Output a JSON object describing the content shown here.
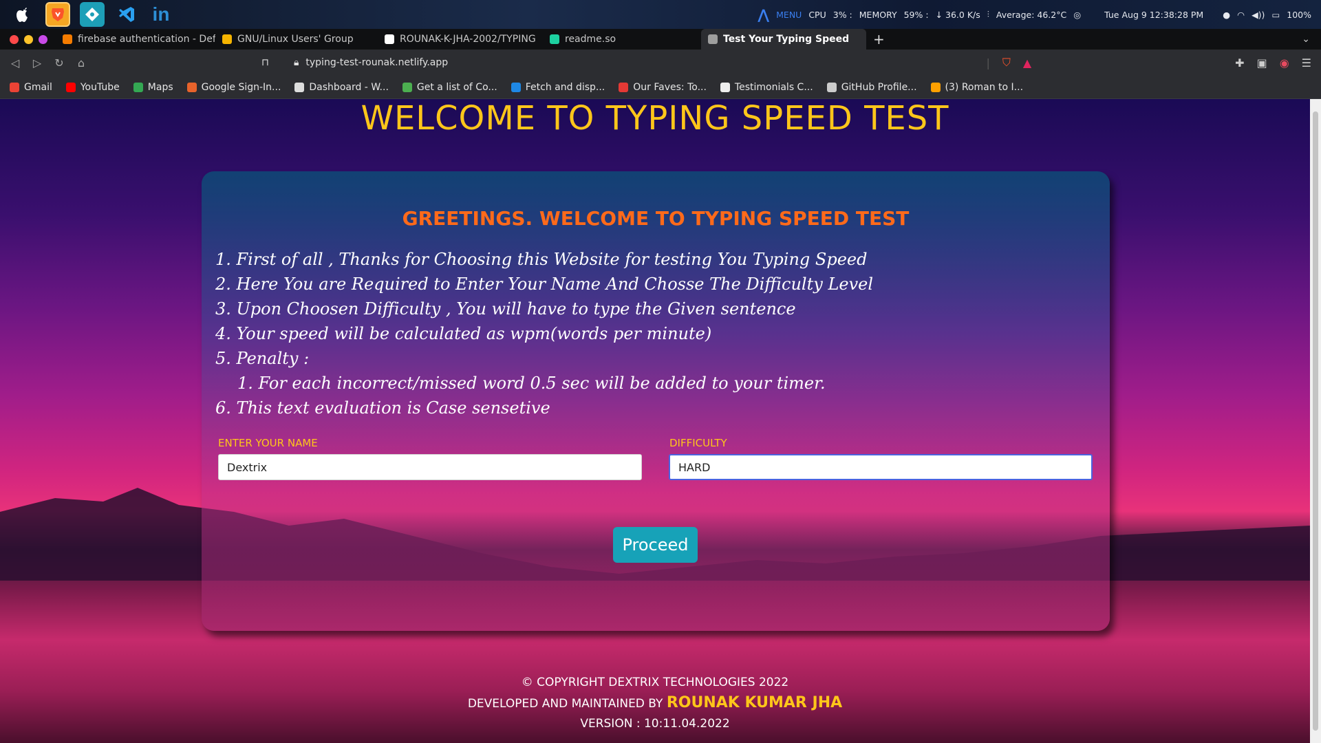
{
  "os_bar": {
    "status": {
      "menu": "MENU",
      "cpu_label": "CPU",
      "cpu_value": "3% :",
      "memory_label": "MEMORY",
      "memory_value": "59% :",
      "net": "↓ 36.0 K/s",
      "temp": "Average: 46.2°C",
      "datetime": "Tue Aug 9  12:38:28 PM",
      "battery": "100%"
    }
  },
  "browser": {
    "tabs": [
      {
        "label": "firebase authentication - Def",
        "fav_color": "#f57c00"
      },
      {
        "label": "GNU/Linux Users' Group",
        "fav_color": "#f5b400"
      },
      {
        "label": "ROUNAK-K-JHA-2002/TYPING",
        "fav_color": "#ffffff"
      },
      {
        "label": "readme.so",
        "fav_color": "#1dd1a1"
      },
      {
        "label": "Test Your Typing Speed",
        "fav_color": "#9e9e9e"
      }
    ],
    "url": "typing-test-rounak.netlify.app",
    "bookmarks": [
      {
        "label": "Gmail",
        "fav_color": "#ea4335"
      },
      {
        "label": "YouTube",
        "fav_color": "#ff0000"
      },
      {
        "label": "Maps",
        "fav_color": "#34a853"
      },
      {
        "label": "Google Sign-In...",
        "fav_color": "#e8632b"
      },
      {
        "label": "Dashboard - W...",
        "fav_color": "#dddddd"
      },
      {
        "label": "Get a list of Co...",
        "fav_color": "#4caf50"
      },
      {
        "label": "Fetch and disp...",
        "fav_color": "#1e88e5"
      },
      {
        "label": "Our Faves: To...",
        "fav_color": "#e53935"
      },
      {
        "label": "Testimonials C...",
        "fav_color": "#eeeeee"
      },
      {
        "label": "GitHub Profile...",
        "fav_color": "#cccccc"
      },
      {
        "label": "(3) Roman to I...",
        "fav_color": "#ffa000"
      }
    ]
  },
  "page": {
    "heading": "WELCOME TO TYPING SPEED TEST",
    "card_heading": "GREETINGS. WELCOME TO TYPING SPEED TEST",
    "rules": [
      "1. First of all , Thanks for Choosing this Website for testing You Typing Speed",
      "2. Here You are Required to Enter Your Name And Chosse The Difficulty Level",
      "3. Upon Choosen Difficulty , You will have to type the Given sentence",
      "4. Your speed will be calculated as wpm(words per minute)",
      "5. Penalty :"
    ],
    "sub_rules": [
      "1. For each incorrect/missed word 0.5 sec will be added to your timer."
    ],
    "rule_6": "6. This text evaluation is Case sensetive",
    "name_label": "ENTER YOUR NAME",
    "name_value": "Dextrix",
    "difficulty_label": "DIFFICULTY",
    "difficulty_value": "HARD",
    "proceed_label": "Proceed",
    "footer_copyright": "© COPYRIGHT DEXTRIX TECHNOLOGIES 2022",
    "footer_developed": "DEVELOPED AND MAINTAINED BY ",
    "footer_author": "ROUNAK KUMAR JHA",
    "footer_version": "VERSION : 10:11.04.2022"
  },
  "colors": {
    "heading": "#ffc61a",
    "card_heading": "#ff6a1a",
    "button": "#17a2b8"
  }
}
